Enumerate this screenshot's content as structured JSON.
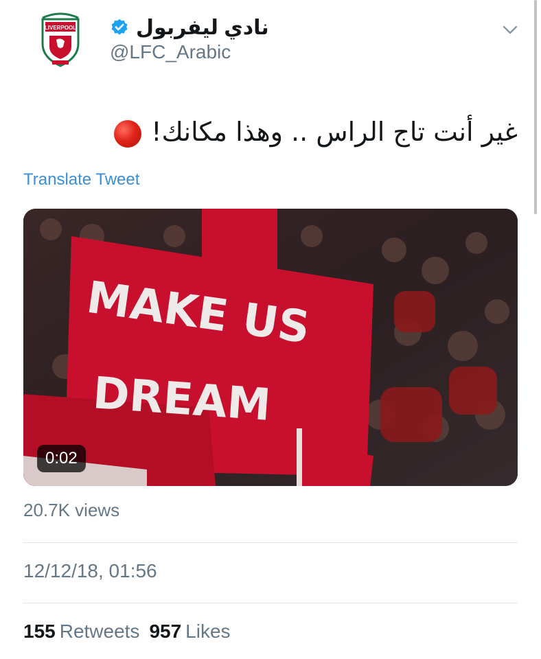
{
  "tweet": {
    "display_name": "نادي ليفربول",
    "handle": "@LFC_Arabic",
    "verified_icon": "verified-badge-icon",
    "avatar_icon": "liverpool-crest-icon",
    "avatar_text": "LIVERPOOL",
    "text": "غير أنت تاج الراس .. وهذا مكانك!",
    "emoji_icon": "red-circle-icon",
    "translate_label": "Translate Tweet",
    "menu_icon": "chevron-down-icon"
  },
  "video": {
    "banner_line1": "MAKE US",
    "banner_line2": "DREAM",
    "duration": "0:02"
  },
  "meta": {
    "views": "20.7K views",
    "datetime": "12/12/18, 01:56",
    "retweets_count": "155",
    "retweets_label": "Retweets",
    "likes_count": "957",
    "likes_label": "Likes"
  },
  "colors": {
    "link": "#3a8fd8",
    "verified": "#1da1f2",
    "banner_red": "#c8102e",
    "secondary_text": "#657786"
  }
}
